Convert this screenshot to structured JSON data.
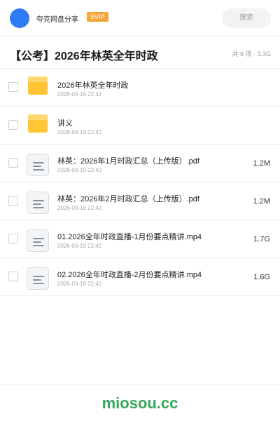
{
  "header": {
    "user_name": "夸克网盘分享",
    "badge": "SVIP",
    "search_label": "搜索"
  },
  "page": {
    "title": "【公考】2026年林英全年时政",
    "summary": "共 6 项 · 3.3G"
  },
  "items": [
    {
      "type": "folder",
      "icon": "folder-icon",
      "name": "2026年林英全年时政",
      "date": "2026-03-19 22:42",
      "size": ""
    },
    {
      "type": "folder",
      "icon": "folder-icon",
      "name": "讲义",
      "date": "2026-03-19 22:42",
      "size": ""
    },
    {
      "type": "file",
      "icon": "document-icon",
      "name": "林英：2026年1月时政汇总（上传版）.pdf",
      "date": "2026-03-19 22:42",
      "size": "1.2M"
    },
    {
      "type": "file",
      "icon": "document-icon",
      "name": "林英：2026年2月时政汇总（上传版）.pdf",
      "date": "2026-03-19 22:42",
      "size": "1.2M"
    },
    {
      "type": "file",
      "icon": "document-icon",
      "name": "01.2026全年时政直播-1月份要点精讲.mp4",
      "date": "2026-03-19 22:42",
      "size": "1.7G"
    },
    {
      "type": "file",
      "icon": "document-icon",
      "name": "02.2026全年时政直播-2月份要点精讲.mp4",
      "date": "2026-03-19 22:42",
      "size": "1.6G"
    }
  ],
  "footer": {
    "brand": "miosou.cc"
  },
  "colors": {
    "avatar": "#2f7bf5",
    "svip": "#f7a53b",
    "folder": "#ffc533",
    "brand": "#35a85a"
  }
}
